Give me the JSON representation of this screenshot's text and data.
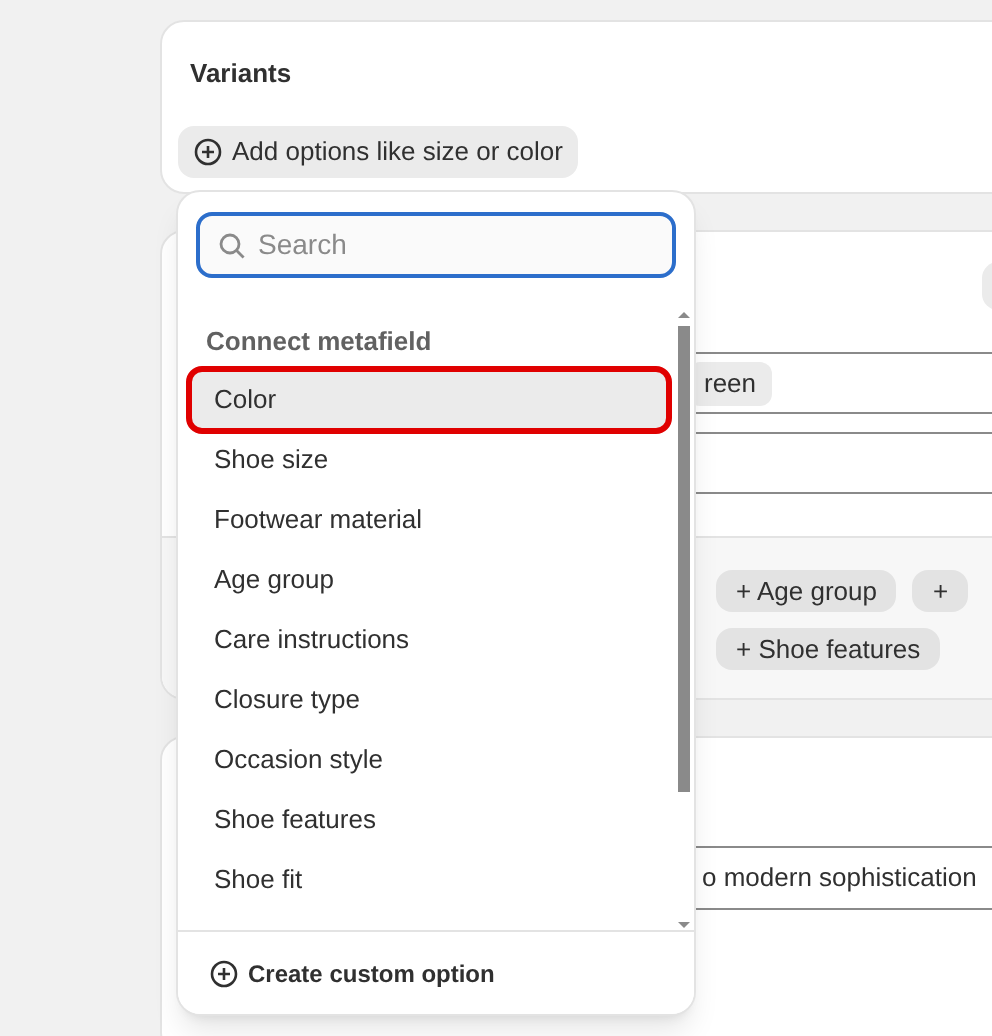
{
  "card_title": "Variants",
  "add_button": "Add options like size or color",
  "dropdown": {
    "search": {
      "placeholder": "Search"
    },
    "section": "Connect metafield",
    "items": [
      {
        "label": "Color",
        "selected": true
      },
      {
        "label": "Shoe size",
        "selected": false
      },
      {
        "label": "Footwear material",
        "selected": false
      },
      {
        "label": "Age group",
        "selected": false
      },
      {
        "label": "Care instructions",
        "selected": false
      },
      {
        "label": "Closure type",
        "selected": false
      },
      {
        "label": "Occasion style",
        "selected": false
      },
      {
        "label": "Shoe features",
        "selected": false
      },
      {
        "label": "Shoe fit",
        "selected": false
      }
    ],
    "footer": "Create custom option"
  },
  "background": {
    "value_chip": "reen",
    "chip_rows": [
      [
        "+ Age group",
        "+"
      ],
      [
        "+ Shoe features"
      ]
    ],
    "field_text": "o modern sophistication"
  }
}
